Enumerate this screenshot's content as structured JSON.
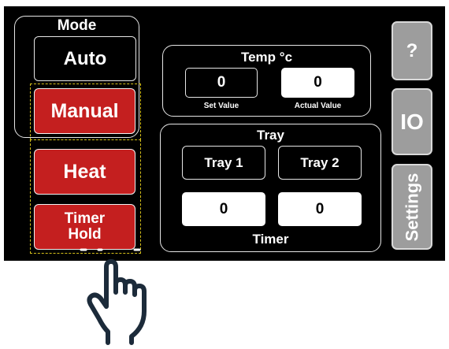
{
  "mode": {
    "title": "Mode",
    "auto_label": "Auto",
    "manual_label": "Manual"
  },
  "heat_label": "Heat",
  "timer_hold": {
    "line1": "Timer",
    "line2": "Hold"
  },
  "temp": {
    "title": "Temp °c",
    "set_value": "0",
    "set_value_label": "Set Value",
    "actual_value": "0",
    "actual_value_label": "Actual Value"
  },
  "tray": {
    "title": "Tray",
    "tray1_label": "Tray 1",
    "tray2_label": "Tray 2",
    "tray1_timer": "0",
    "tray2_timer": "0",
    "timer_label": "Timer"
  },
  "side": {
    "help_label": "?",
    "io_label": "IO",
    "settings_label": "Settings"
  },
  "colors": {
    "panel_bg": "#000000",
    "button_red": "#c41f1f",
    "side_gray": "#9d9d9d",
    "selection_dash": "#d8c21a",
    "hand_stroke": "#1c2b3a"
  },
  "icons": {
    "pointer": "hand-pointer-icon"
  }
}
